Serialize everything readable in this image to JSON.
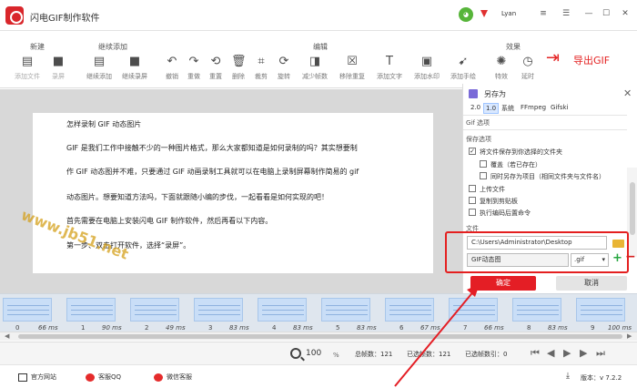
{
  "app": {
    "title": "闪电GIF制作软件",
    "username": "Lyan"
  },
  "toolbar": {
    "groups": {
      "new": "新建",
      "continue_add": "继续添加",
      "edit": "编辑",
      "effects": "效果"
    },
    "add_file": "添加文件",
    "record": "录屏",
    "continue_add_file": "继续添加",
    "continue_record": "继续录屏",
    "undo": "撤销",
    "redo": "重做",
    "reset": "重置",
    "delete": "删除",
    "crop": "裁剪",
    "rotate": "旋转",
    "reduce_frames": "减少帧数",
    "remove_dup": "移除重复",
    "add_text": "添加文字",
    "add_watermark": "添加水印",
    "add_cursor": "添加手绘",
    "effect": "特效",
    "delay": "延时",
    "export": "导出GIF"
  },
  "document": {
    "lines": [
      "怎样录制 GIF 动态图片",
      "GIF 是我们工作中接触不少的一种图片格式，那么大家都知道是如何录制的吗？其实想要制",
      "作 GIF 动态图并不难，只要通过 GIF 动画录制工具就可以在电脑上录制屏幕制作简易的 gif",
      "动态图片。想要知道方法吗，下面就跟随小编的步伐，一起看看是如何实现的吧！",
      "首先需要在电脑上安装闪电 GIF 制作软件，然后再看以下内容。",
      "第一步、双击打开软件，选择“录屏”。"
    ],
    "watermark": "www.jb51.net"
  },
  "dialog": {
    "title": "另存为",
    "tabs": [
      "2.0",
      "1.0",
      "系统",
      "FFmpeg",
      "Gifski"
    ],
    "active_tab": "1.0",
    "gif_options": "Gif 选项",
    "save_options": "保存选项",
    "save_to_folder": "将文件保存到你选择的文件夹",
    "overwrite": "覆盖（若已存在）",
    "save_project": "同时另存为项目（相同文件夹与文件名）",
    "upload_file": "上传文件",
    "copy_clipboard": "复制到剪贴板",
    "run_command": "执行编码后置命令",
    "file_label": "文件",
    "path": "C:\\Users\\Administrator\\Desktop",
    "filename": "GIF动态图",
    "extension": ".gif",
    "ok": "确定",
    "cancel": "取消"
  },
  "frames": [
    {
      "no": "0",
      "ms": "66 ms"
    },
    {
      "no": "1",
      "ms": "90 ms"
    },
    {
      "no": "2",
      "ms": "49 ms"
    },
    {
      "no": "3",
      "ms": "83 ms"
    },
    {
      "no": "4",
      "ms": "83 ms"
    },
    {
      "no": "5",
      "ms": "83 ms"
    },
    {
      "no": "6",
      "ms": "67 ms"
    },
    {
      "no": "7",
      "ms": "66 ms"
    },
    {
      "no": "8",
      "ms": "83 ms"
    },
    {
      "no": "9",
      "ms": "100 ms"
    }
  ],
  "status": {
    "zoom": "100",
    "zoom_unit": "%",
    "total_frames": "总帧数：121",
    "selected_frames": "已选帧数：121",
    "selected_index": "已选帧数引：0"
  },
  "footer": {
    "website": "官方网站",
    "qq": "客服QQ",
    "wechat": "微信客服",
    "version": "版本：v 7.2.2"
  }
}
